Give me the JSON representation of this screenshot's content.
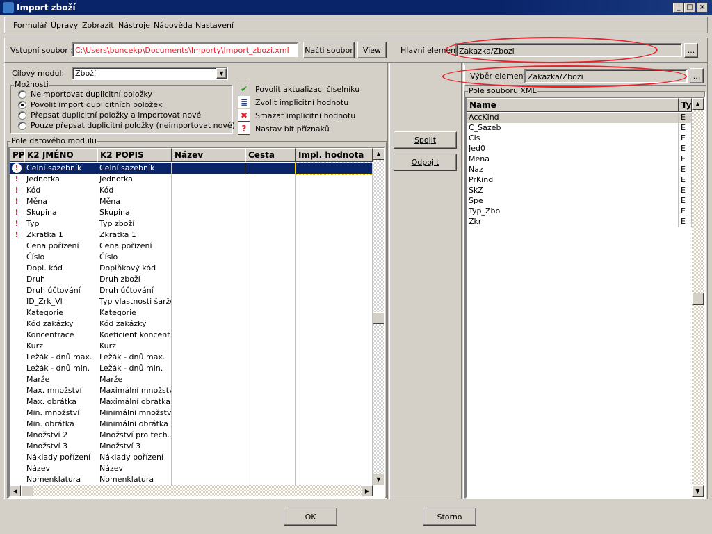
{
  "window": {
    "title": "Import zboží"
  },
  "menu": [
    "Formulář",
    "Úpravy",
    "Zobrazit",
    "Nástroje",
    "Nápověda",
    "Nastavení"
  ],
  "input_file": {
    "label": "Vstupní soubor :",
    "value": "C:\\Users\\buncekp\\Documents\\Importy\\Import_zbozi.xml",
    "load_button": "Načti soubor",
    "view_button": "View"
  },
  "main_element": {
    "label": "Hlavní element:",
    "value": "Zakazka/Zbozi",
    "browse": "..."
  },
  "target_module": {
    "label": "Cílový modul:",
    "value": "Zboží"
  },
  "options": {
    "title": "Možnosti",
    "items": [
      "Neimportovat duplicitní položky",
      "Povolit import duplicitních položek",
      "Přepsat duplicitní položky a importovat nové",
      "Pouze přepsat duplicitní položky (neimportovat nové)"
    ],
    "selected": 1
  },
  "actions": [
    {
      "icon": "check-icon",
      "label": "Povolit aktualizaci číselníku"
    },
    {
      "icon": "document-icon",
      "label": "Zvolit implicitní hodnotu"
    },
    {
      "icon": "red-x-icon",
      "label": "Smazat implicitní hodnotu"
    },
    {
      "icon": "question-icon",
      "label": "Nastav bit příznaků"
    }
  ],
  "module_fields": {
    "title": "Pole datového modulu",
    "columns": [
      "PP",
      "K2 JMÉNO",
      "K2 POPIS",
      "Název",
      "Cesta",
      "Impl. hodnota"
    ],
    "sort_indicator": "2",
    "rows": [
      [
        "!",
        "Celní sazebník",
        "Celní sazebník"
      ],
      [
        "!",
        "Jednotka",
        "Jednotka"
      ],
      [
        "!",
        "Kód",
        "Kód"
      ],
      [
        "!",
        "Měna",
        "Měna"
      ],
      [
        "!",
        "Skupina",
        "Skupina"
      ],
      [
        "!",
        "Typ",
        "Typ zboží"
      ],
      [
        "!",
        "Zkratka 1",
        "Zkratka 1"
      ],
      [
        "",
        "Cena pořízení",
        "Cena pořízení"
      ],
      [
        "",
        "Číslo",
        "Číslo"
      ],
      [
        "",
        "Dopl. kód",
        "Doplňkový kód"
      ],
      [
        "",
        "Druh",
        "Druh zboží"
      ],
      [
        "",
        "Druh účtování",
        "Druh účtování"
      ],
      [
        "",
        "ID_Zrk_Vl",
        "Typ vlastnosti šarže"
      ],
      [
        "",
        "Kategorie",
        "Kategorie"
      ],
      [
        "",
        "Kód zakázky",
        "Kód zakázky"
      ],
      [
        "",
        "Koncentrace",
        "Koeficient koncent..."
      ],
      [
        "",
        "Kurz",
        "Kurz"
      ],
      [
        "",
        "Ležák - dnů max.",
        "Ležák - dnů max."
      ],
      [
        "",
        "Ležák - dnů min.",
        "Ležák - dnů min."
      ],
      [
        "",
        "Marže",
        "Marže"
      ],
      [
        "",
        "Max. množství",
        "Maximální množstv..."
      ],
      [
        "",
        "Max. obrátka",
        "Maximální obrátka"
      ],
      [
        "",
        "Min. množství",
        "Minimální množství..."
      ],
      [
        "",
        "Min. obrátka",
        "Minimální obrátka"
      ],
      [
        "",
        "Množství 2",
        "Množství pro tech..."
      ],
      [
        "",
        "Množství 3",
        "Množství 3"
      ],
      [
        "",
        "Náklady pořízení",
        "Náklady pořízení"
      ],
      [
        "",
        "Název",
        "Název"
      ],
      [
        "",
        "Nomenklatura",
        "Nomenklatura"
      ]
    ],
    "selected_row": 0
  },
  "connect_button": "Spojit",
  "disconnect_button": "Odpojit",
  "element_select": {
    "label": "Výběr elementu:",
    "value": "Zakazka/Zbozi",
    "browse": "..."
  },
  "xml_fields": {
    "title": "Pole souboru XML",
    "columns": [
      "Name",
      "Ty"
    ],
    "sort_indicator": "1",
    "rows": [
      [
        "AccKind",
        "E"
      ],
      [
        "C_Sazeb",
        "E"
      ],
      [
        "Cis",
        "E"
      ],
      [
        "Jed0",
        "E"
      ],
      [
        "Mena",
        "E"
      ],
      [
        "Naz",
        "E"
      ],
      [
        "PrKind",
        "E"
      ],
      [
        "SkZ",
        "E"
      ],
      [
        "Spe",
        "E"
      ],
      [
        "Typ_Zbo",
        "E"
      ],
      [
        "Zkr",
        "E"
      ]
    ],
    "selected_row": 0
  },
  "footer": {
    "ok": "OK",
    "cancel": "Storno"
  },
  "colors": {
    "titlebar": "#0a246a",
    "selection": "#0a246a",
    "path_text": "#e8202a",
    "annotation": "#e8202a",
    "required": "#e8202a"
  }
}
